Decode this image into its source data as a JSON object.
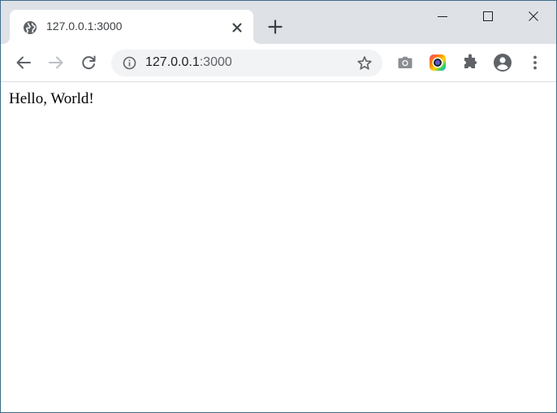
{
  "tab": {
    "title": "127.0.0.1:3000",
    "favicon": "globe-icon"
  },
  "window_controls": {
    "minimize": "minimize-icon",
    "maximize": "maximize-icon",
    "close": "close-icon"
  },
  "toolbar": {
    "back": "arrow-left-icon",
    "forward": "arrow-right-icon",
    "reload": "reload-icon"
  },
  "omnibox": {
    "host": "127.0.0.1",
    "port": ":3000",
    "info": "info-icon",
    "bookmark": "star-icon"
  },
  "extensions": [
    "camera-icon",
    "color-picker-icon",
    "puzzle-icon",
    "profile-icon",
    "more-vert-icon"
  ],
  "page": {
    "text": "Hello, World!"
  },
  "colors": {
    "tabstrip": "#dee1e6",
    "omnibox": "#f1f3f4",
    "text": "#202124",
    "icon": "#5f6368"
  }
}
